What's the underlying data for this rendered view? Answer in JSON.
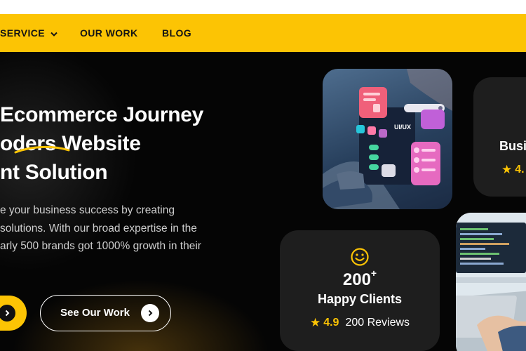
{
  "nav": {
    "items": [
      {
        "label": "SERVICE"
      },
      {
        "label": "OUR WORK"
      },
      {
        "label": "BLOG"
      }
    ]
  },
  "hero": {
    "headline": [
      "Ecommerce Journey",
      "oders Website",
      "nt Solution"
    ],
    "description": [
      "e your business success by creating",
      "solutions. With our broad expertise in the",
      "arly 500 brands got 1000% growth in their"
    ],
    "secondary_button_label": "See Our Work"
  },
  "stats": {
    "clients": {
      "number": "200",
      "suffix": "+",
      "label": "Happy Clients",
      "rating": "4.9",
      "reviews": "200 Reviews"
    },
    "partial": {
      "label": "Busi",
      "rating": "4."
    }
  },
  "colors": {
    "accent": "#fcc404",
    "card_bg": "#1e1e1e",
    "page_bg": "#050505"
  },
  "icons": [
    "chevron-down-icon",
    "chevron-right-icon",
    "smiley-icon",
    "star-icon"
  ]
}
